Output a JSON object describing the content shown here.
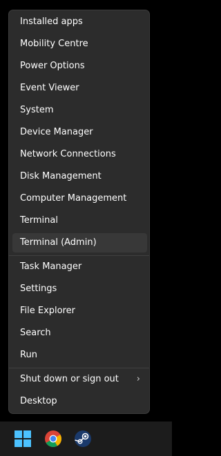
{
  "menu": {
    "items": [
      {
        "label": "Installed apps"
      },
      {
        "label": "Mobility Centre"
      },
      {
        "label": "Power Options"
      },
      {
        "label": "Event Viewer"
      },
      {
        "label": "System"
      },
      {
        "label": "Device Manager"
      },
      {
        "label": "Network Connections"
      },
      {
        "label": "Disk Management"
      },
      {
        "label": "Computer Management"
      },
      {
        "label": "Terminal"
      },
      {
        "label": "Terminal (Admin)"
      },
      {
        "label": "Task Manager"
      },
      {
        "label": "Settings"
      },
      {
        "label": "File Explorer"
      },
      {
        "label": "Search"
      },
      {
        "label": "Run"
      },
      {
        "label": "Shut down or sign out"
      },
      {
        "label": "Desktop"
      }
    ],
    "submenu_glyph": "›",
    "colors": {
      "background": "#2c2c2c",
      "hover": "#383838",
      "text": "#ffffff"
    }
  },
  "taskbar": {
    "icons": [
      "windows-start-icon",
      "chrome-icon",
      "steam-icon"
    ]
  }
}
